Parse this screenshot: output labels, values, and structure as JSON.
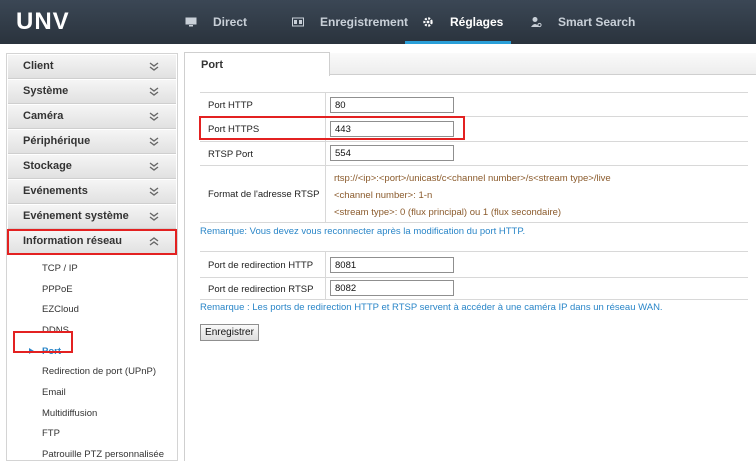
{
  "brand": {
    "logo": "UNV"
  },
  "nav": {
    "items": [
      {
        "label": "Direct",
        "icon": "monitor-icon"
      },
      {
        "label": "Enregistrement",
        "icon": "recorder-icon"
      },
      {
        "label": "Réglages",
        "icon": "gear-icon",
        "active": true
      },
      {
        "label": "Smart Search",
        "icon": "person-search-icon"
      }
    ]
  },
  "sidebar": {
    "sections": [
      {
        "label": "Client"
      },
      {
        "label": "Système"
      },
      {
        "label": "Caméra"
      },
      {
        "label": "Périphérique"
      },
      {
        "label": "Stockage"
      },
      {
        "label": "Evénements"
      },
      {
        "label": "Evénement système"
      },
      {
        "label": "Information réseau",
        "open": true
      }
    ],
    "subitems": [
      {
        "label": "TCP / IP"
      },
      {
        "label": "PPPoE"
      },
      {
        "label": "EZCloud"
      },
      {
        "label": "DDNS"
      },
      {
        "label": "Port",
        "selected": true
      },
      {
        "label": "Redirection de port (UPnP)"
      },
      {
        "label": "Email"
      },
      {
        "label": "Multidiffusion"
      },
      {
        "label": "FTP"
      },
      {
        "label": "Patrouille PTZ personnalisée"
      }
    ]
  },
  "main": {
    "tab": "Port",
    "port_http": {
      "label": "Port HTTP",
      "value": "80"
    },
    "port_https": {
      "label": "Port HTTPS",
      "value": "443"
    },
    "rtsp_port": {
      "label": "RTSP Port",
      "value": "554"
    },
    "rtsp_format": {
      "label": "Format de l'adresse RTSP",
      "lines": [
        "rtsp://<ip>:<port>/unicast/c<channel number>/s<stream type>/live",
        "<channel number>: 1-n",
        "<stream type>: 0 (flux principal) ou 1 (flux secondaire)"
      ]
    },
    "note1": "Remarque: Vous devez vous reconnecter après la modification du port HTTP.",
    "redir_http": {
      "label": "Port de redirection HTTP",
      "value": "8081"
    },
    "redir_rtsp": {
      "label": "Port de redirection RTSP",
      "value": "8082"
    },
    "note2": "Remarque : Les ports de redirection HTTP et RTSP servent à accéder à une caméra IP dans un réseau WAN.",
    "save_label": "Enregistrer"
  },
  "colors": {
    "accent": "#2a86c8",
    "highlight": "#e32121",
    "topbar": "#2f3a45"
  }
}
